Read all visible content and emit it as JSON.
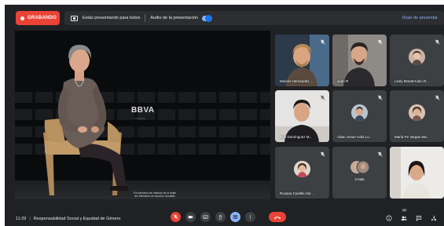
{
  "recording": {
    "label": "GRABANDO",
    "color": "#ea4335"
  },
  "presenting": {
    "text": "Estás presentando para todos",
    "audio_label": "Audio de la presentación",
    "audio_on": true,
    "stop_label": "Dejar de presentar"
  },
  "stage": {
    "logo": "BBVA",
    "logo_sub": "Fundación",
    "caption_line1": "Fui directora del Instituto de la Mujer",
    "caption_line2": "del Ministerio de Asuntos Sociales"
  },
  "participants": [
    {
      "name": "Moisés Hernández ...",
      "kind": "video-man-blonde",
      "muted": true
    },
    {
      "name": "Juan R",
      "kind": "video-man-dark",
      "muted": true
    },
    {
      "name": "Lesly Monterrubio R...",
      "kind": "avatar",
      "muted": true
    },
    {
      "name": "Noé Domínguez M...",
      "kind": "video-man-young",
      "muted": true
    },
    {
      "name": "Adan Josue Avila Lo...",
      "kind": "avatar",
      "muted": true
    },
    {
      "name": "María Fe Vargas Ma...",
      "kind": "avatar",
      "muted": true
    },
    {
      "name": "Roxana Castillo Abr...",
      "kind": "avatar",
      "muted": true
    },
    {
      "name": "4 más",
      "kind": "more",
      "muted": true
    },
    {
      "name": "",
      "kind": "video-woman",
      "muted": true
    }
  ],
  "bottom": {
    "time": "11:29",
    "separator": "|",
    "meeting_title": "Responsabilidad Social y Equidad de Género",
    "people_count": "20"
  },
  "icons": {
    "mic": "mic-off-icon",
    "camera": "camera-icon",
    "captions": "closed-captions-icon",
    "raise_hand": "raise-hand-icon",
    "present": "present-screen-icon",
    "more": "more-options-icon",
    "hangup": "hang-up-icon",
    "info": "info-icon",
    "people": "people-icon",
    "chat": "chat-icon",
    "activities": "activities-icon"
  },
  "colors": {
    "accent": "#8ab4f8",
    "danger": "#ea4335",
    "bar": "#202124",
    "tile": "#3c4043"
  }
}
